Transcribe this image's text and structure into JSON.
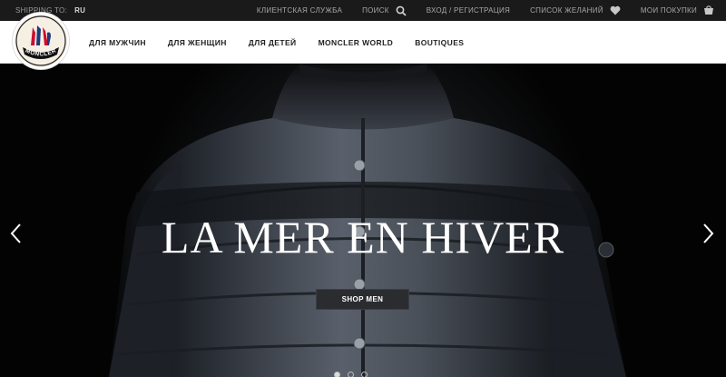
{
  "topbar": {
    "shipping_label": "SHIPPING TO:",
    "shipping_country": "RU",
    "links": {
      "service": "КЛИЕНТСКАЯ СЛУЖБА",
      "search": "ПОИСК",
      "login": "ВХОД / РЕГИСТРАЦИЯ",
      "wishlist": "СПИСОК ЖЕЛАНИЙ",
      "cart": "МОИ ПОКУПКИ"
    }
  },
  "brand": {
    "logo_text": "MONCLER"
  },
  "nav": {
    "items": [
      "ДЛЯ МУЖЧИН",
      "ДЛЯ ЖЕНЩИН",
      "ДЛЯ ДЕТЕЙ",
      "MONCLER WORLD",
      "BOUTIQUES"
    ]
  },
  "hero": {
    "headline": "LA MER EN HIVER",
    "cta_label": "SHOP MEN",
    "slides_total": 3,
    "active_slide": 1
  },
  "icons": [
    "search-icon",
    "heart-icon",
    "cart-icon",
    "chevron-left-icon",
    "chevron-right-icon"
  ],
  "colors": {
    "topbar_bg": "#1a1a1a",
    "nav_bg": "#ffffff",
    "hero_bg": "#030303",
    "cta_bg": "#2a2c30"
  }
}
